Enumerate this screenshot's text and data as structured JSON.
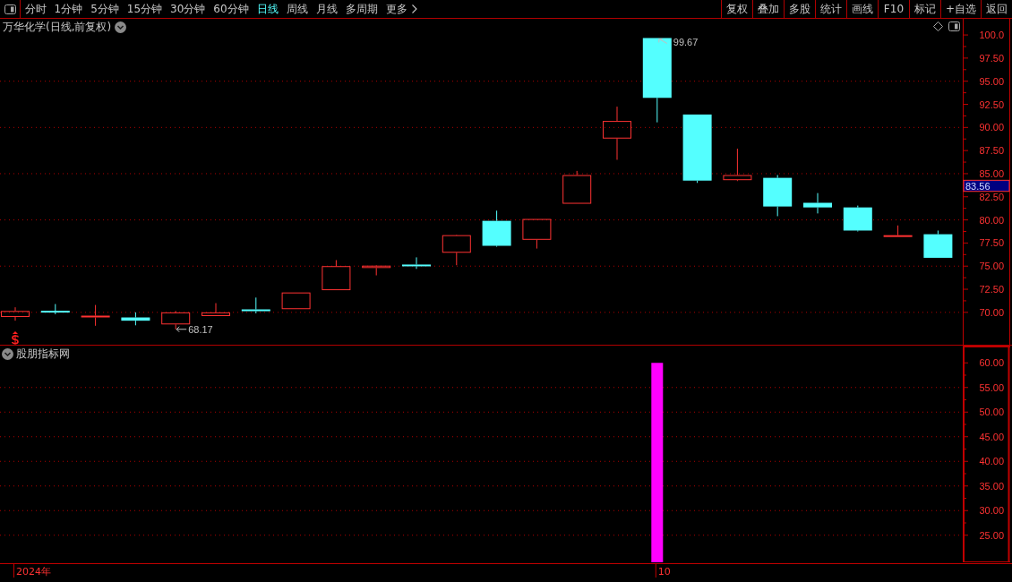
{
  "toolbar": {
    "tabs": [
      {
        "label": "分时",
        "kind": "period",
        "selected": false
      },
      {
        "label": "1分钟",
        "kind": "period",
        "selected": false
      },
      {
        "label": "5分钟",
        "kind": "period",
        "selected": false
      },
      {
        "label": "15分钟",
        "kind": "period",
        "selected": false
      },
      {
        "label": "30分钟",
        "kind": "period",
        "selected": false
      },
      {
        "label": "60分钟",
        "kind": "period",
        "selected": false
      },
      {
        "label": "日线",
        "kind": "period",
        "selected": true
      },
      {
        "label": "周线",
        "kind": "period",
        "selected": false
      },
      {
        "label": "月线",
        "kind": "period",
        "selected": false
      },
      {
        "label": "多周期",
        "kind": "period",
        "selected": false
      },
      {
        "label": "更多",
        "kind": "menu",
        "selected": false
      }
    ],
    "buttons": [
      "复权",
      "叠加",
      "多股",
      "统计",
      "画线",
      "F10",
      "标记",
      "+自选",
      "返回"
    ]
  },
  "price_pane": {
    "title": "万华化学(日线,前复权)",
    "price_tag": {
      "label": "83.56",
      "color": "#000080"
    },
    "chart_data": {
      "type": "candlestick",
      "ohlc": [
        [
          69.5,
          70.55,
          69.1,
          70.15
        ],
        [
          70.15,
          70.9,
          69.8,
          70.0
        ],
        [
          69.5,
          70.8,
          68.55,
          69.6
        ],
        [
          69.45,
          70.0,
          68.6,
          69.1
        ],
        [
          68.7,
          70.15,
          68.17,
          70.0
        ],
        [
          69.6,
          71.0,
          69.6,
          70.0
        ],
        [
          70.25,
          71.6,
          69.9,
          70.2
        ],
        [
          70.35,
          72.15,
          70.35,
          72.15
        ],
        [
          72.4,
          75.65,
          72.4,
          75.0
        ],
        [
          74.8,
          75.1,
          74.0,
          75.05
        ],
        [
          75.1,
          75.95,
          74.7,
          75.05
        ],
        [
          76.45,
          78.4,
          75.1,
          78.35
        ],
        [
          79.9,
          81.0,
          77.1,
          77.2
        ],
        [
          77.85,
          80.1,
          76.9,
          80.1
        ],
        [
          81.75,
          85.3,
          81.75,
          84.85
        ],
        [
          88.8,
          92.25,
          86.5,
          90.7
        ],
        [
          99.67,
          99.67,
          90.55,
          93.2
        ],
        [
          91.4,
          91.4,
          84.0,
          84.25
        ],
        [
          84.3,
          87.7,
          84.2,
          84.85
        ],
        [
          84.55,
          84.85,
          80.4,
          81.45
        ],
        [
          81.85,
          82.9,
          80.7,
          81.35
        ],
        [
          81.35,
          81.55,
          78.75,
          78.85
        ],
        [
          78.2,
          79.4,
          78.2,
          78.3
        ],
        [
          78.45,
          78.85,
          75.9,
          75.9
        ]
      ],
      "ylim": [
        66.5,
        101.75
      ],
      "yticks": [
        {
          "value": 70,
          "label": "70.00"
        },
        {
          "value": 72.5,
          "label": "72.50"
        },
        {
          "value": 75,
          "label": "75.00"
        },
        {
          "value": 77.5,
          "label": "77.50"
        },
        {
          "value": 80,
          "label": "80.00"
        },
        {
          "value": 82.5,
          "label": "82.50"
        },
        {
          "value": 85,
          "label": "85.00"
        },
        {
          "value": 87.5,
          "label": "87.50"
        },
        {
          "value": 90,
          "label": "90.00"
        },
        {
          "value": 92.5,
          "label": "92.50"
        },
        {
          "value": 95,
          "label": "95.00"
        },
        {
          "value": 97.5,
          "label": "97.50"
        },
        {
          "value": 100,
          "label": "100.0"
        }
      ],
      "grid": true,
      "annotations": [
        "99.67",
        "68.17"
      ]
    }
  },
  "indicator_pane": {
    "title": "股朋指标网",
    "chart_data": {
      "type": "bar",
      "categories": [
        "2024年",
        null,
        null,
        null,
        null,
        null,
        null,
        null,
        null,
        null,
        null,
        null,
        null,
        null,
        null,
        null,
        "10",
        null,
        null,
        null,
        null,
        null,
        null,
        null
      ],
      "values": [
        null,
        null,
        null,
        null,
        null,
        null,
        null,
        null,
        null,
        null,
        null,
        null,
        null,
        null,
        null,
        null,
        60,
        null,
        null,
        null,
        null,
        null,
        null,
        null
      ],
      "color": "#ff00ff",
      "ylim": [
        19.5,
        63.5
      ],
      "yticks": [
        {
          "value": 25,
          "label": "25.00"
        },
        {
          "value": 30,
          "label": "30.00"
        },
        {
          "value": 35,
          "label": "35.00"
        },
        {
          "value": 40,
          "label": "40.00"
        },
        {
          "value": 45,
          "label": "45.00"
        },
        {
          "value": 50,
          "label": "50.00"
        },
        {
          "value": 55,
          "label": "55.00"
        },
        {
          "value": 60,
          "label": "60.00"
        }
      ],
      "grid": true
    }
  }
}
